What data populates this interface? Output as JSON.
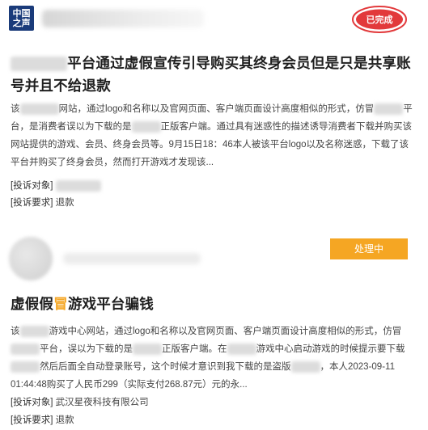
{
  "complaints": [
    {
      "logo_line1": "中国",
      "logo_line2": "之声",
      "status": "已完成",
      "title_rest": "平台通过虚假宣传引导购买其终身会员但是只是共享账号并且不给退款",
      "body_parts": {
        "p1": "该",
        "p2": "网站，通过logo和名称以及官网页面、客户端页面设计高度相似的形式，仿冒",
        "p3": "平台，是消费者误以为下载的是",
        "p4": "正版客户端。通过具有迷惑性的描述诱导消费者下载并购买该网站提供的游戏、会员、终身会员等。9月15日18：46本人被该平台logo以及名称迷惑，下载了该平台并购买了终身会员，然而打开游戏才发现该..."
      },
      "object_label": "[投诉对象]",
      "object_value": "",
      "request_label": "[投诉要求]",
      "request_value": "退款"
    },
    {
      "status": "处理中",
      "title_prefix": "虚假假",
      "title_highlight": "冒",
      "title_suffix": "游戏平台骗钱",
      "body_parts": {
        "p1": "该",
        "p2": "游戏中心网站，通过logo和名称以及官网页面、客户端页面设计高度相似的形式，仿冒",
        "p3": "平台，误以为下载的是",
        "p4": "正版客户端。在",
        "p5": "游戏中心启动游戏的时候提示要下载",
        "p6": "然后后面全自动登录账号，这个时候才意识到我下载的是盗版",
        "p7": "，本人2023-09-11 01:44:48购买了人民币299（实际支付268.87元）元的永..."
      },
      "object_label": "[投诉对象]",
      "object_value": "武汉星夜科技有限公司",
      "request_label": "[投诉要求]",
      "request_value": "退款"
    }
  ],
  "colors": {
    "badge_done": "#e2393b",
    "badge_processing": "#f5a623",
    "logo_bg": "#1a3b7a"
  }
}
